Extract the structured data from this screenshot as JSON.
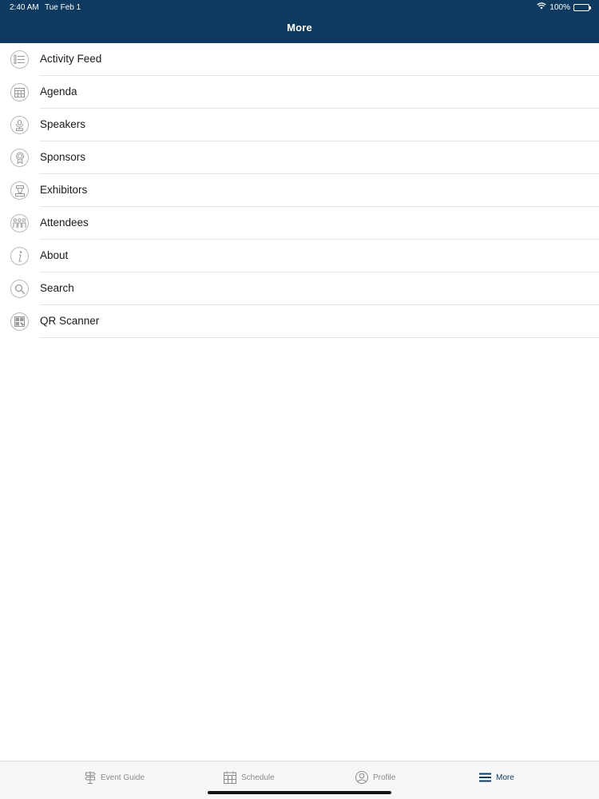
{
  "status_bar": {
    "time": "2:40 AM",
    "date": "Tue Feb 1",
    "battery_percent": "100%",
    "battery_level": 1.0
  },
  "header": {
    "title": "More",
    "background_color": "#0d3a5e"
  },
  "menu": {
    "items": [
      {
        "label": "Activity Feed",
        "icon": "activity-feed-icon"
      },
      {
        "label": "Agenda",
        "icon": "calendar-icon"
      },
      {
        "label": "Speakers",
        "icon": "speaker-icon"
      },
      {
        "label": "Sponsors",
        "icon": "ribbon-award-icon"
      },
      {
        "label": "Exhibitors",
        "icon": "booth-icon"
      },
      {
        "label": "Attendees",
        "icon": "people-icon"
      },
      {
        "label": "About",
        "icon": "info-icon"
      },
      {
        "label": "Search",
        "icon": "search-icon"
      },
      {
        "label": "QR Scanner",
        "icon": "qr-code-icon"
      }
    ]
  },
  "tab_bar": {
    "tabs": [
      {
        "label": "Event Guide",
        "icon": "signpost-icon",
        "active": false
      },
      {
        "label": "Schedule",
        "icon": "calendar-icon",
        "active": false
      },
      {
        "label": "Profile",
        "icon": "profile-icon",
        "active": false
      },
      {
        "label": "More",
        "icon": "hamburger-menu-icon",
        "active": true
      }
    ],
    "active_color": "#0d3a5e",
    "inactive_color": "#8a8a8a"
  }
}
